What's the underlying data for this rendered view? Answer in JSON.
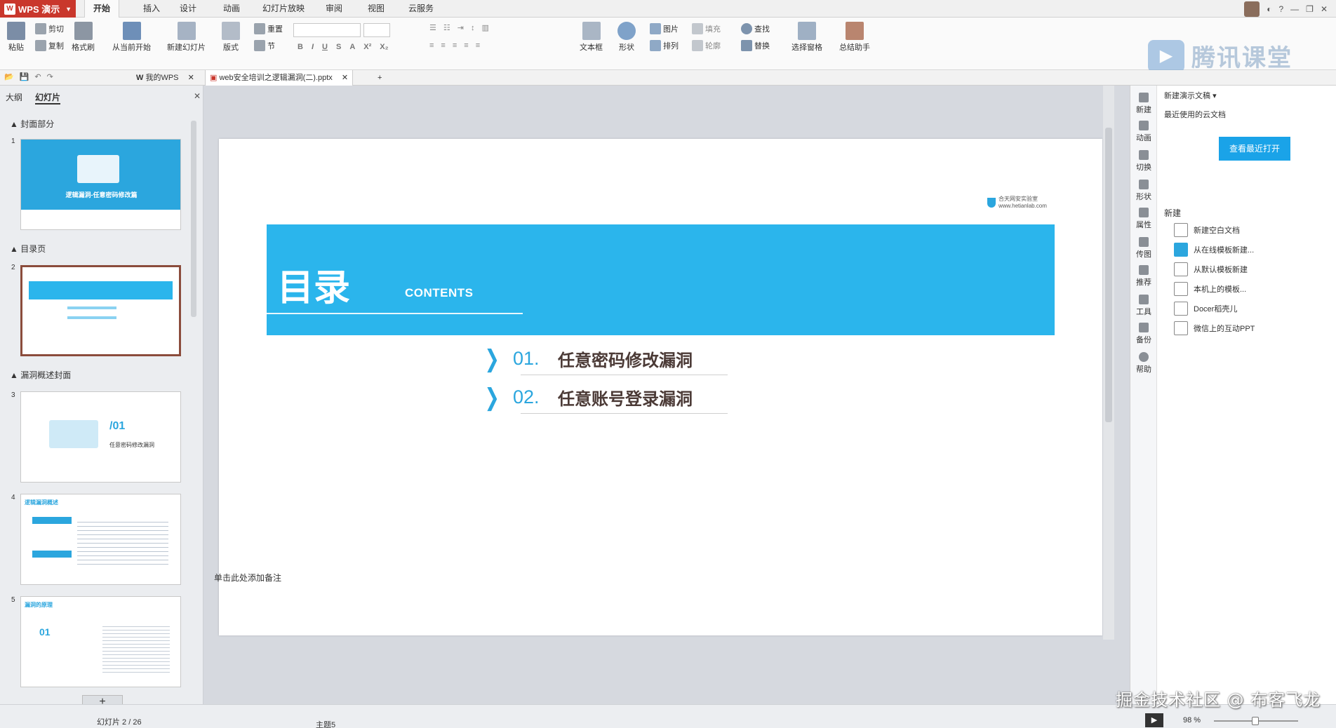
{
  "app": {
    "name": "WPS 演示"
  },
  "menu": {
    "tabs": [
      "开始",
      "插入",
      "设计",
      "动画",
      "幻灯片放映",
      "审阅",
      "视图",
      "云服务"
    ],
    "active": 0
  },
  "ribbon": {
    "paste": "粘贴",
    "cut": "剪切",
    "copy": "复制",
    "format_painter": "格式刷",
    "from_current": "从当前开始",
    "new_slide": "新建幻灯片",
    "layout": "版式",
    "reset": "重置",
    "section": "节",
    "textbox": "文本框",
    "shape": "形状",
    "picture": "图片",
    "arrange": "排列",
    "fill": "填充",
    "outline": "轮廓",
    "find": "查找",
    "replace": "替换",
    "select_pane": "选择窗格",
    "summary": "总结助手"
  },
  "brand_watermark": {
    "text": "腾讯课堂"
  },
  "doc_tabs": {
    "my_wps": "我的WPS",
    "file": "web安全培训之逻辑漏洞(二).pptx"
  },
  "left_panel": {
    "tabs": [
      "大纲",
      "幻灯片"
    ],
    "sections": [
      "封面部分",
      "目录页",
      "漏洞概述封面"
    ],
    "slide_numbers": [
      "1",
      "2",
      "3",
      "4",
      "5"
    ],
    "thumb1_title": "逻辑漏洞-任意密码修改篇",
    "thumb3_num": "/01",
    "thumb3_title": "任意密码修改漏洞",
    "thumb4_title": "逻辑漏洞概述",
    "thumb5_title": "漏洞的原理",
    "thumb5_num": "01",
    "add_slide": "+"
  },
  "slide": {
    "logo_text": "合天网安实验室",
    "logo_sub": "www.hetianlab.com",
    "title": "目录",
    "subtitle": "CONTENTS",
    "items": [
      {
        "num": "01.",
        "text": "任意密码修改漏洞"
      },
      {
        "num": "02.",
        "text": "任意账号登录漏洞"
      }
    ],
    "notes_placeholder": "单击此处添加备注",
    "accent": "#2bb5ec"
  },
  "right_panel": {
    "header": "新建演示文稿",
    "recent_label": "最近使用的云文档",
    "open_recent_btn": "查看最近打开",
    "new_label": "新建",
    "new_items": [
      "新建空白文档",
      "从在线模板新建...",
      "从默认模板新建",
      "本机上的模板...",
      "Docer稻壳儿",
      "微信上的互动PPT"
    ],
    "tools": [
      "新建",
      "动画",
      "切换",
      "形状",
      "属性",
      "传图",
      "推荐",
      "工具",
      "备份",
      "帮助"
    ]
  },
  "status": {
    "slide_indicator": "幻灯片 2 / 26",
    "theme": "主题5",
    "zoom": "98 %",
    "zoom_level": 0.49
  },
  "site_watermark": "掘金技术社区 @ 布客飞龙"
}
